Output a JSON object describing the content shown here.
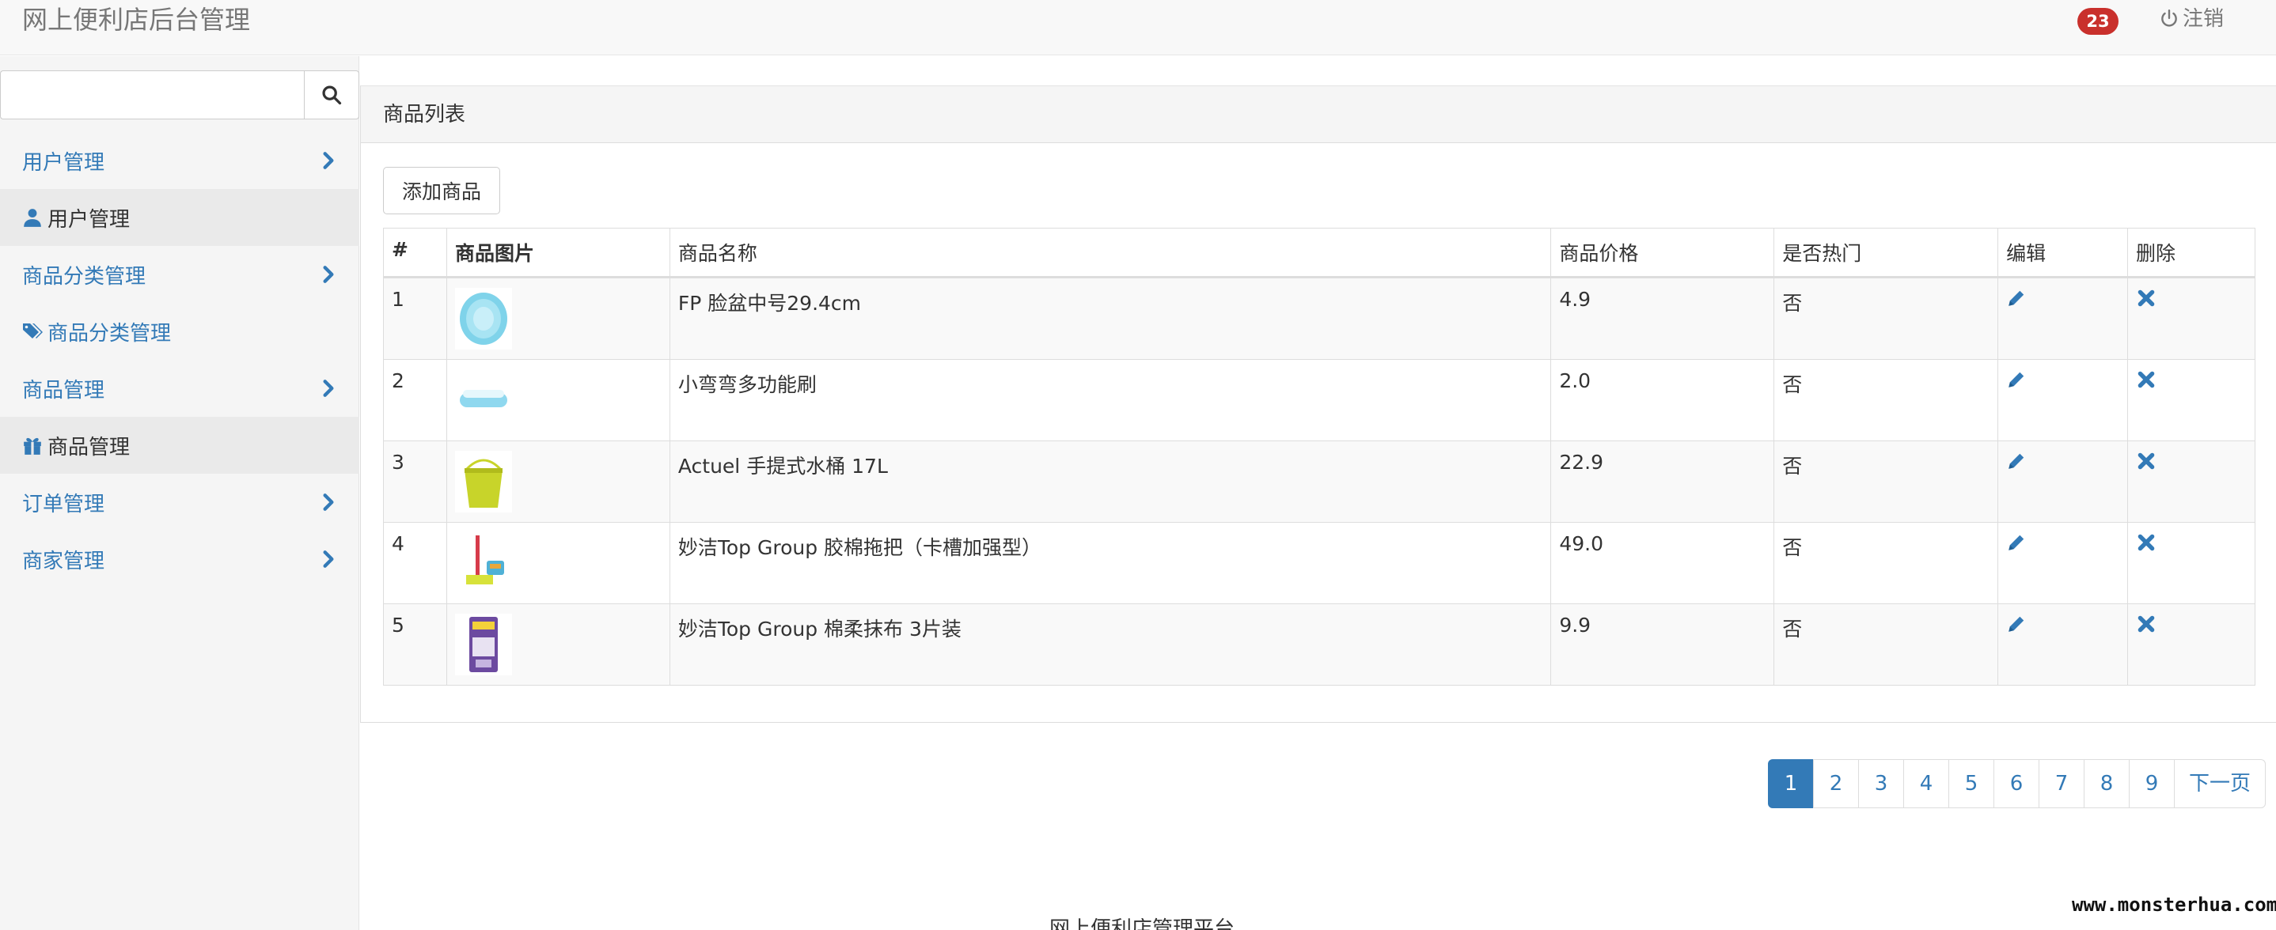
{
  "navbar": {
    "brand": "网上便利店后台管理",
    "badge_count": "23",
    "logout_label": "注销"
  },
  "sidebar": {
    "search": {
      "value": "",
      "placeholder": ""
    },
    "items": [
      {
        "label": "用户管理",
        "type": "group"
      },
      {
        "label": "用户管理",
        "type": "sub",
        "icon": "user-icon"
      },
      {
        "label": "商品分类管理",
        "type": "group"
      },
      {
        "label": "商品分类管理",
        "type": "sub",
        "icon": "tags-icon"
      },
      {
        "label": "商品管理",
        "type": "group"
      },
      {
        "label": "商品管理",
        "type": "sub",
        "icon": "gift-icon"
      },
      {
        "label": "订单管理",
        "type": "group"
      },
      {
        "label": "商家管理",
        "type": "group"
      }
    ]
  },
  "panel": {
    "title": "商品列表",
    "add_button": "添加商品",
    "columns": [
      "#",
      "商品图片",
      "商品名称",
      "商品价格",
      "是否热门",
      "编辑",
      "删除"
    ],
    "rows": [
      {
        "id": "1",
        "name": "FP 脸盆中号29.4cm",
        "price": "4.9",
        "hot": "否",
        "image": "basin-icon"
      },
      {
        "id": "2",
        "name": "小弯弯多功能刷",
        "price": "2.0",
        "hot": "否",
        "image": "brush-icon"
      },
      {
        "id": "3",
        "name": "Actuel 手提式水桶 17L",
        "price": "22.9",
        "hot": "否",
        "image": "bucket-icon"
      },
      {
        "id": "4",
        "name": "妙洁Top Group 胶棉拖把（卡槽加强型）",
        "price": "49.0",
        "hot": "否",
        "image": "mop-icon"
      },
      {
        "id": "5",
        "name": "妙洁Top Group 棉柔抹布 3片装",
        "price": "9.9",
        "hot": "否",
        "image": "cloth-icon"
      }
    ]
  },
  "pagination": {
    "pages": [
      "1",
      "2",
      "3",
      "4",
      "5",
      "6",
      "7",
      "8",
      "9"
    ],
    "active": "1",
    "next_label": "下一页"
  },
  "footer": {
    "text": "网上便利店管理平台",
    "watermark": "www.monsterhua.com"
  },
  "colors": {
    "link": "#337ab7",
    "badge": "#c9302c",
    "navbar_bg": "#f8f8f8",
    "sidebar_bg": "#f5f5f5"
  }
}
